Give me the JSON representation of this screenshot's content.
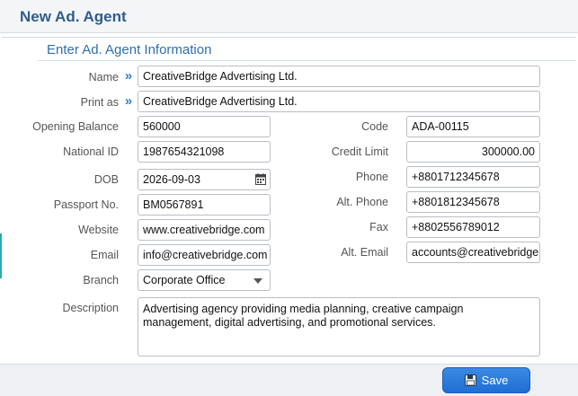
{
  "header": {
    "title": "New Ad. Agent"
  },
  "section": {
    "title": "Enter Ad. Agent Information"
  },
  "fields": {
    "name": {
      "label": "Name",
      "value": "CreativeBridge Advertising Ltd."
    },
    "print_as": {
      "label": "Print as",
      "value": "CreativeBridge Advertising Ltd."
    },
    "opening_balance": {
      "label": "Opening Balance",
      "value": "560000"
    },
    "code": {
      "label": "Code",
      "value": "ADA-00115"
    },
    "national_id": {
      "label": "National ID",
      "value": "1987654321098"
    },
    "credit_limit": {
      "label": "Credit Limit",
      "value": "300000.00"
    },
    "dob": {
      "label": "DOB",
      "value": "2026-09-03"
    },
    "phone": {
      "label": "Phone",
      "value": "+8801712345678"
    },
    "passport": {
      "label": "Passport No.",
      "value": "BM0567891"
    },
    "alt_phone": {
      "label": "Alt. Phone",
      "value": "+8801812345678"
    },
    "website": {
      "label": "Website",
      "value": "www.creativebridge.com"
    },
    "fax": {
      "label": "Fax",
      "value": "+8802556789012"
    },
    "email": {
      "label": "Email",
      "value": "info@creativebridge.com"
    },
    "alt_email": {
      "label": "Alt. Email",
      "value": "accounts@creativebridge.com"
    },
    "branch": {
      "label": "Branch",
      "value": "Corporate Office"
    },
    "description": {
      "label": "Description",
      "value": "Advertising agency providing media planning, creative campaign management, digital advertising, and promotional services."
    }
  },
  "footer": {
    "save_label": "Save"
  },
  "icons": {
    "expand": "chevron-right-double-icon",
    "calendar": "calendar-icon",
    "save": "floppy-disk-icon",
    "dropdown": "caret-down-icon"
  },
  "colors": {
    "title": "#2e5d8e",
    "section": "#2f6fae",
    "chevron": "#2f7fd0",
    "button": "#1f6fd3"
  }
}
